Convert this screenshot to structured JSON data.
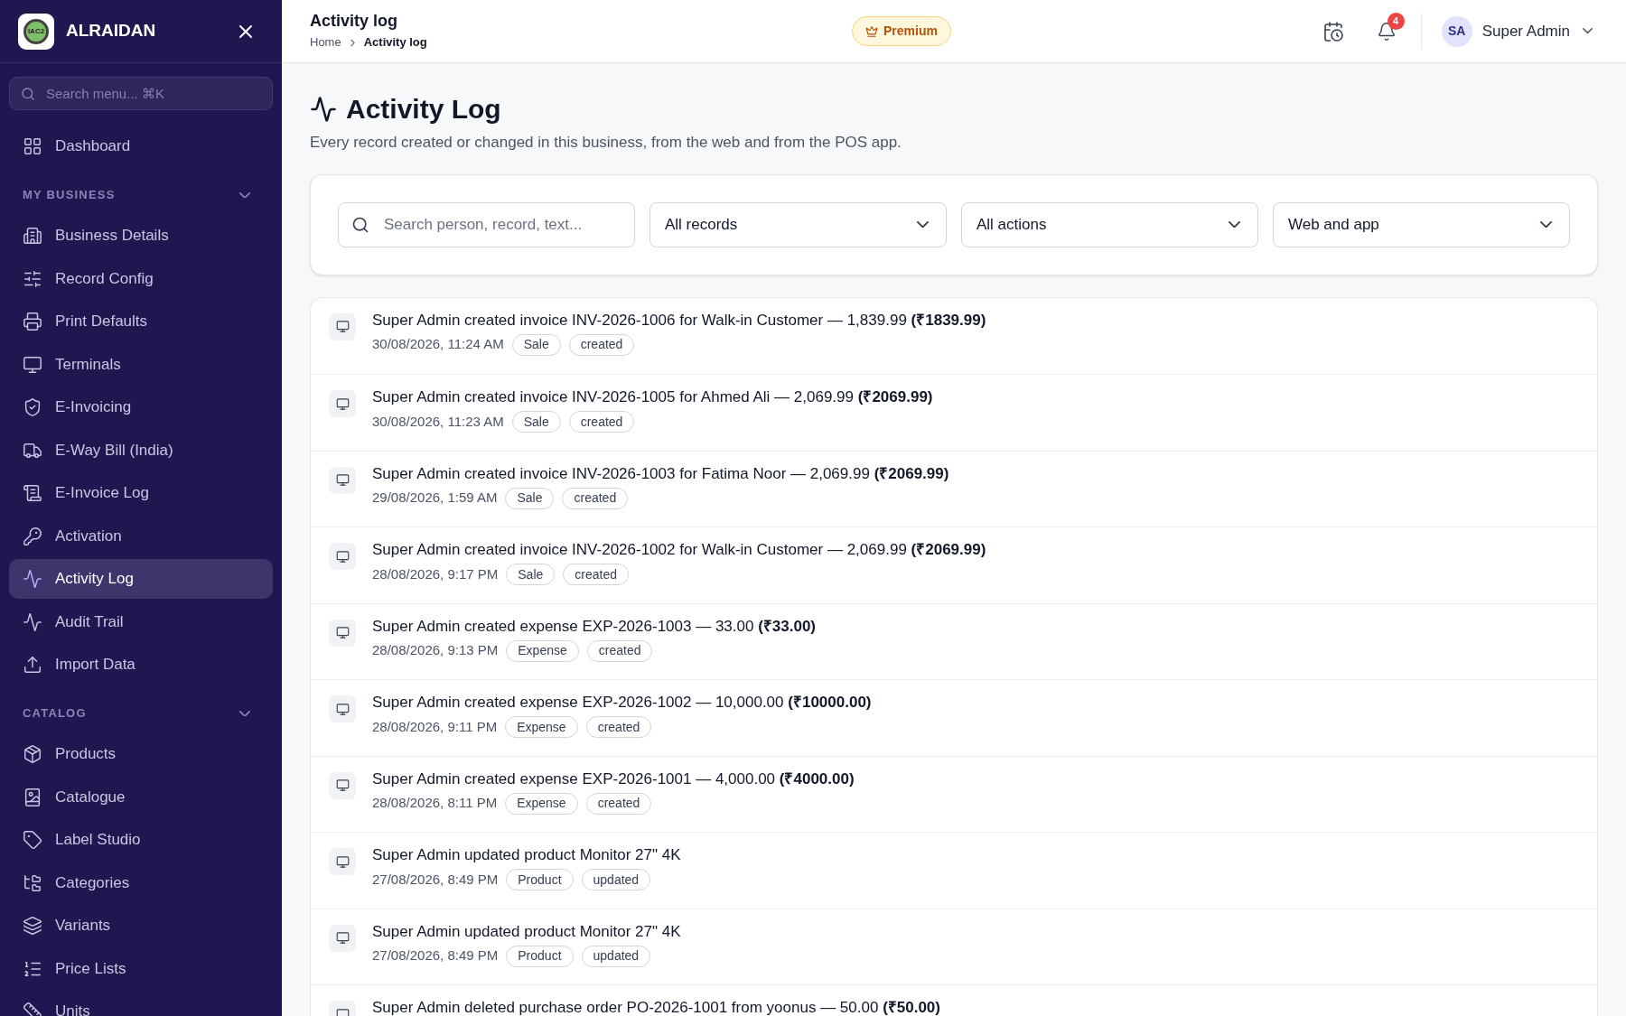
{
  "brand": {
    "name": "ALRAIDAN",
    "logo_text": "IAC2"
  },
  "sidebar": {
    "search": {
      "placeholder": "Search menu... ⌘K"
    },
    "top_items": [
      {
        "label": "Dashboard",
        "selected": false
      }
    ],
    "sections": [
      {
        "title": "MY BUSINESS",
        "expanded": true,
        "items": [
          {
            "label": "Business Details",
            "selected": false
          },
          {
            "label": "Record Config",
            "selected": false
          },
          {
            "label": "Print Defaults",
            "selected": false
          },
          {
            "label": "Terminals",
            "selected": false
          },
          {
            "label": "E-Invoicing",
            "selected": false
          },
          {
            "label": "E-Way Bill (India)",
            "selected": false
          },
          {
            "label": "E-Invoice Log",
            "selected": false
          },
          {
            "label": "Activation",
            "selected": false
          },
          {
            "label": "Activity Log",
            "selected": true
          },
          {
            "label": "Audit Trail",
            "selected": false
          },
          {
            "label": "Import Data",
            "selected": false
          }
        ]
      },
      {
        "title": "CATALOG",
        "expanded": true,
        "items": [
          {
            "label": "Products",
            "selected": false
          },
          {
            "label": "Catalogue",
            "selected": false
          },
          {
            "label": "Label Studio",
            "selected": false
          },
          {
            "label": "Categories",
            "selected": false
          },
          {
            "label": "Variants",
            "selected": false
          },
          {
            "label": "Price Lists",
            "selected": false
          },
          {
            "label": "Units",
            "selected": false
          }
        ]
      }
    ]
  },
  "header": {
    "title": "Activity log",
    "breadcrumb": [
      "Home",
      "Activity log"
    ],
    "badge": "Premium",
    "notifications": "4",
    "user": {
      "initials": "SA",
      "name": "Super Admin"
    }
  },
  "page": {
    "title": "Activity Log",
    "subtitle": "Every record created or changed in this business, from the web and from the POS app."
  },
  "filters": {
    "search": {
      "placeholder": "Search person, record, text..."
    },
    "selects": [
      "All records",
      "All actions",
      "Web and app"
    ]
  },
  "entries": [
    {
      "text": "Super Admin created invoice INV-2026-1006 for Walk-in Customer — 1,839.99 **(₹1839.99)**",
      "time": "30/08/2026, 11:24 AM",
      "tags": [
        "Sale",
        "created"
      ]
    },
    {
      "text": "Super Admin created invoice INV-2026-1005 for Ahmed Ali — 2,069.99 **(₹2069.99)**",
      "time": "30/08/2026, 11:23 AM",
      "tags": [
        "Sale",
        "created"
      ]
    },
    {
      "text": "Super Admin created invoice INV-2026-1003 for Fatima Noor — 2,069.99 **(₹2069.99)**",
      "time": "29/08/2026, 1:59 AM",
      "tags": [
        "Sale",
        "created"
      ]
    },
    {
      "text": "Super Admin created invoice INV-2026-1002 for Walk-in Customer — 2,069.99 **(₹2069.99)**",
      "time": "28/08/2026, 9:17 PM",
      "tags": [
        "Sale",
        "created"
      ]
    },
    {
      "text": "Super Admin created expense EXP-2026-1003 — 33.00 **(₹33.00)**",
      "time": "28/08/2026, 9:13 PM",
      "tags": [
        "Expense",
        "created"
      ]
    },
    {
      "text": "Super Admin created expense EXP-2026-1002 — 10,000.00 **(₹10000.00)**",
      "time": "28/08/2026, 9:11 PM",
      "tags": [
        "Expense",
        "created"
      ]
    },
    {
      "text": "Super Admin created expense EXP-2026-1001 — 4,000.00 **(₹4000.00)**",
      "time": "28/08/2026, 8:11 PM",
      "tags": [
        "Expense",
        "created"
      ]
    },
    {
      "text": "Super Admin updated product Monitor 27\" 4K",
      "time": "27/08/2026, 8:49 PM",
      "tags": [
        "Product",
        "updated"
      ]
    },
    {
      "text": "Super Admin updated product Monitor 27\" 4K",
      "time": "27/08/2026, 8:49 PM",
      "tags": [
        "Product",
        "updated"
      ]
    },
    {
      "text": "Super Admin deleted purchase order PO-2026-1001 from yoonus — 50.00 **(₹50.00)**"
    }
  ]
}
